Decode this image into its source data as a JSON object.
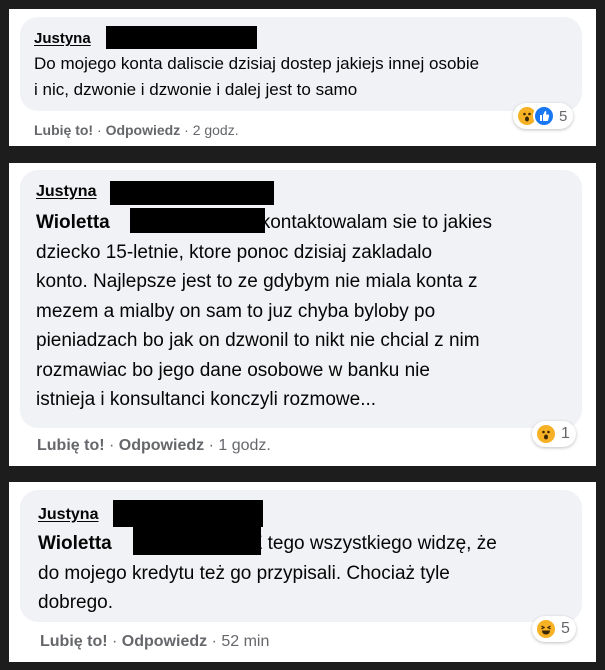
{
  "comments": [
    {
      "author": "Justyna",
      "text_lines": [
        "Do mojego konta daliscie dzisiaj dostep jakiejs innej osobie",
        "i nic, dzwonie i dzwonie i dalej jest to samo"
      ],
      "like_label": "Lubię to!",
      "reply_label": "Odpowiedz",
      "time": "2 godz.",
      "reaction_icons": [
        "wow-emoji-icon",
        "like-icon"
      ],
      "reaction_count": "5"
    },
    {
      "author": "Justyna",
      "mention": "Wioletta",
      "text_first": "kontaktowalam sie to jakies",
      "text_lines": [
        "dziecko 15-letnie, ktore ponoc dzisiaj zakladalo",
        "konto. Najlepsze jest to ze gdybym nie miala konta z",
        "mezem a mialby on sam to juz chyba byloby po",
        "pieniadzach bo jak on dzwonil to nikt nie chcial z nim",
        "rozmawiac bo jego dane osobowe w banku nie",
        "istnieja i konsultanci konczyli rozmowe..."
      ],
      "like_label": "Lubię to!",
      "reply_label": "Odpowiedz",
      "time": "1 godz.",
      "reaction_icons": [
        "wow-emoji-icon"
      ],
      "reaction_count": "1"
    },
    {
      "author": "Justyna",
      "mention": "Wioletta",
      "text_first": "Z tego wszystkiego widzę, że",
      "text_lines": [
        "do mojego kredytu też go przypisali. Chociaż tyle",
        "dobrego."
      ],
      "like_label": "Lubię to!",
      "reply_label": "Odpowiedz",
      "time": "52 min",
      "reaction_icons": [
        "haha-emoji-icon"
      ],
      "reaction_count": "5"
    }
  ],
  "colors": {
    "page_background": "#1d1d1d",
    "bubble": "#f0f2f5",
    "meta_text": "#65676b",
    "like_blue": "#1877f2",
    "emoji_yellow": "#f7b125"
  }
}
